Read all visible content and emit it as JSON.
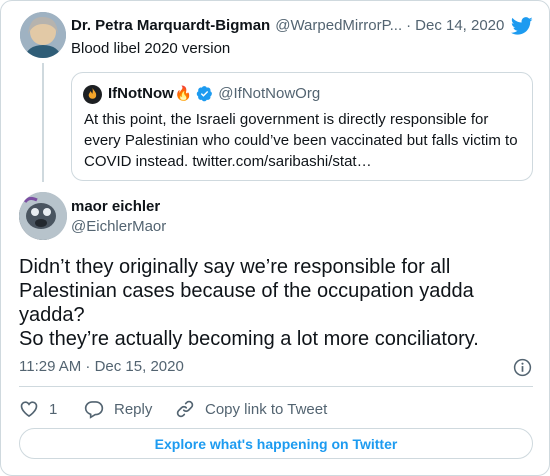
{
  "parent_tweet": {
    "author_name": "Dr. Petra Marquardt-Bigman",
    "author_handle": "@WarpedMirrorP...",
    "separator": "·",
    "date": "Dec 14, 2020",
    "text": "Blood libel 2020 version",
    "avatar_icon": "user-avatar"
  },
  "quoted_tweet": {
    "author_name": "IfNotNow",
    "author_emoji": "🔥",
    "verified_icon": "verified-badge-icon",
    "author_handle": "@IfNotNowOrg",
    "text": "At this point, the Israeli government is directly responsible for every Palestinian who could’ve been vaccinated but falls victim to COVID instead. twitter.com/saribashi/stat…"
  },
  "main_tweet": {
    "author_name": "maor eichler",
    "author_handle": "@EichlerMaor",
    "text_lines": [
      "Didn’t they originally say we’re responsible for all Palestinian cases because of the occupation yadda yadda?",
      "So they’re actually becoming a lot more conciliatory."
    ],
    "timestamp": "11:29 AM · Dec 15, 2020"
  },
  "actions": {
    "like_count": "1",
    "reply_label": "Reply",
    "copy_link_label": "Copy link to Tweet"
  },
  "explore_label": "Explore what's happening on Twitter",
  "colors": {
    "accent": "#1d9bf0",
    "text": "#0f1419",
    "secondary": "#536471",
    "border": "#cfd9de"
  }
}
